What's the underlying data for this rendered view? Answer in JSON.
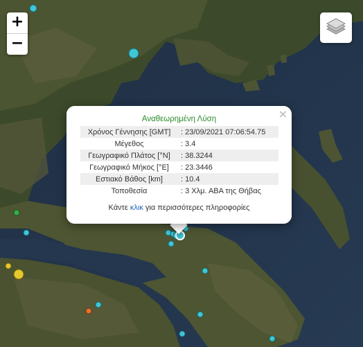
{
  "map": {
    "zoom_in_label": "+",
    "zoom_out_label": "−",
    "layers_icon": "layers-icon"
  },
  "popup": {
    "title": "Αναθεωρημένη Λύση",
    "close_label": "×",
    "rows": [
      {
        "label": "Χρόνος Γέννησης [GMT]",
        "value": ": 23/09/2021 07:06:54.75"
      },
      {
        "label": "Μέγεθος",
        "value": ": 3.4"
      },
      {
        "label": "Γεωγραφικό Πλάτος [°N]",
        "value": ": 38.3244"
      },
      {
        "label": "Γεωγραφικό Μήκος [°E]",
        "value": ": 23.3446"
      },
      {
        "label": "Εστιακό Βάθος [km]",
        "value": ": 10.4"
      },
      {
        "label": "Τοποθεσία",
        "value": ": 3 Χλμ. ΑΒΑ της Θήβας"
      }
    ],
    "more_prefix": "Κάντε ",
    "more_link": "κλικ",
    "more_suffix": " για περισσότερες πληροφορίες"
  },
  "colors": {
    "marker_recent": "#3fc6d6",
    "marker_older": "#e6c72e",
    "marker_oldest": "#e8732a",
    "marker_green": "#35b049",
    "title_green": "#2b8a2b",
    "link_blue": "#1f64b8"
  }
}
